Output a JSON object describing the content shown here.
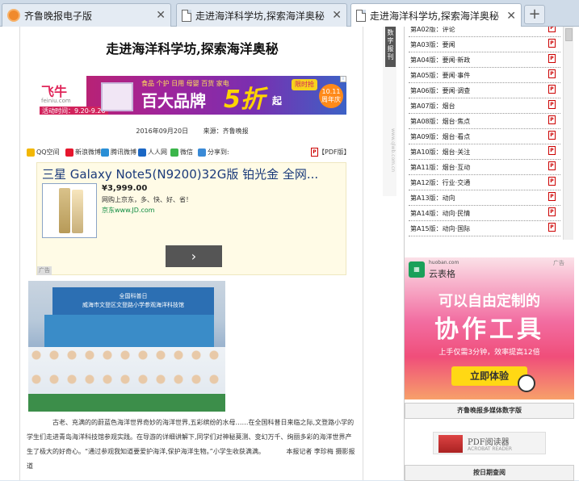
{
  "tabs": [
    {
      "title": "齐鲁晚报电子版",
      "icon": "browser-logo-icon"
    },
    {
      "title": "走进海洋科学坊,探索海洋奥秘",
      "icon": "page-icon"
    },
    {
      "title": "走进海洋科学坊,探索海洋奥秘",
      "icon": "page-icon",
      "active": true
    }
  ],
  "newtab_label": "+",
  "close_glyph": "✕",
  "article": {
    "title": "走进海洋科学坊,探索海洋奥秘",
    "date": "2016年09月20日",
    "source": "来源：齐鲁晚报",
    "share": [
      {
        "label": "QQ空间",
        "color": "#f2b705"
      },
      {
        "label": "新浪微博",
        "color": "#e6162d"
      },
      {
        "label": "腾讯微博",
        "color": "#2a8fd6"
      },
      {
        "label": "人人网",
        "color": "#1b67c4"
      },
      {
        "label": "微信",
        "color": "#3bb54a"
      },
      {
        "label": "分享到:",
        "color": "#3a8ad6"
      }
    ],
    "pdf_link": "【PDF版】",
    "body": "古老、充满的的蔚蓝色海洋世界奇妙的海洋世界,五彩缤纷的水母……在全国科普日来临之际,文登路小学的学生们走进青岛海洋科技馆参观实践。在导游的详细讲解下,同学们对神秘莫测、变幻万千、绚丽多彩的海洋世界产生了极大的好奇心。“通过参观我知道要爱护海洋,保护海洋生物。”小学生收获满满。",
    "byline": "本报记者 李珍梅 摄影报道"
  },
  "banner_ad": {
    "brand": "飞牛",
    "brand_url": "feiniu.com",
    "date_range": "活动时间：9.20-9.26",
    "categories": "食品 个护 日用 母婴 百货 家电",
    "headline": "百大品牌",
    "discount": "5折",
    "suffix": "起",
    "badge": "限时抢",
    "festival": "10.11 周年庆",
    "adchoice": "i"
  },
  "product_ad": {
    "title": "三星 Galaxy Note5(N9200)32G版 铂光金 全网...",
    "price": "¥3,999.00",
    "slogan": "网购上京东，多、快、好、省！",
    "source": "京东www.JD.com",
    "arrow": "›",
    "tag": "广告"
  },
  "photo": {
    "sign_lines": [
      "全国科普日",
      "威海市文登区文登路小学参观海洋科技馆"
    ]
  },
  "side_tabs": {
    "digital": "数字报刊",
    "url": "www.qlwb.com.cn"
  },
  "pages": [
    {
      "label": "第A02版：评论"
    },
    {
      "label": "第A03版：要闻"
    },
    {
      "label": "第A04版：要闻·新政"
    },
    {
      "label": "第A05版：要闻·事件"
    },
    {
      "label": "第A06版：要闻·调查"
    },
    {
      "label": "第A07版：烟台"
    },
    {
      "label": "第A08版：烟台·焦点"
    },
    {
      "label": "第A09版：烟台·看点"
    },
    {
      "label": "第A10版：烟台·关注"
    },
    {
      "label": "第A11版：烟台·互动"
    },
    {
      "label": "第A12版：行业·交通"
    },
    {
      "label": "第A13版：动向"
    },
    {
      "label": "第A14版：动向·民情"
    },
    {
      "label": "第A15版：动向·国际"
    }
  ],
  "cloud_ad": {
    "brand_url": "huoban.com",
    "brand": "云表格",
    "adlabel": "广告",
    "headline1": "可以自由定制的",
    "headline2": "协作工具",
    "sub": "上手仅需3分钟，效率提高12倍",
    "cta": "立即体验"
  },
  "media_header": "齐鲁晚报多媒体数字版",
  "pdf_reader": {
    "title": "PDF阅读器",
    "subtitle": "ACROBAT READER"
  },
  "date_query": "按日期查阅"
}
